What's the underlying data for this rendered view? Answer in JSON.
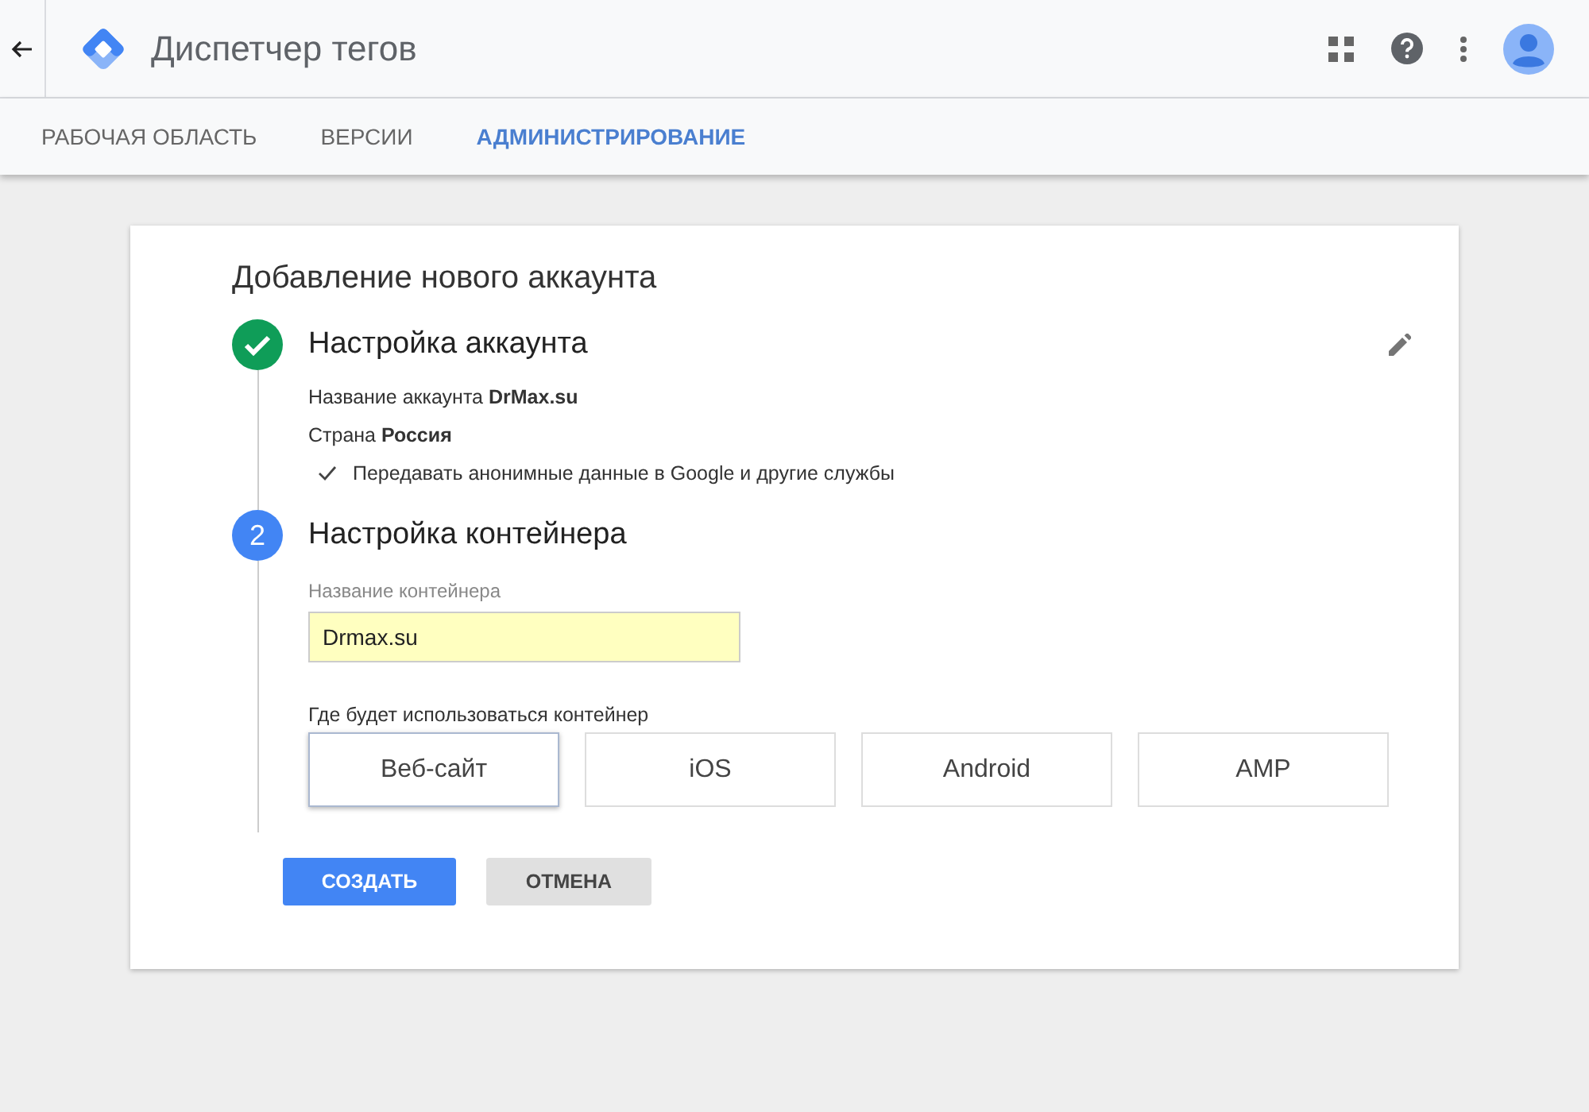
{
  "app": {
    "title": "Диспетчер тегов"
  },
  "tabs": [
    {
      "label": "РАБОЧАЯ ОБЛАСТЬ",
      "selected": false
    },
    {
      "label": "ВЕРСИИ",
      "selected": false
    },
    {
      "label": "АДМИНИСТРИРОВАНИЕ",
      "selected": true
    }
  ],
  "card": {
    "title": "Добавление нового аккаунта",
    "step_1": {
      "completed": true,
      "title": "Настройка аккаунта",
      "details": [
        "Название аккаунта **DrMax.su**",
        "Страна **Россия**"
      ],
      "option": {
        "label": "Передавать анонимные данные в Google и другие службы",
        "checked": true
      }
    },
    "step_2": {
      "completed": false,
      "number": "2",
      "title": "Настройка контейнера",
      "field": {
        "label": "Название контейнера",
        "value": "Drmax.su"
      },
      "platforms_label": "Где будет использоваться контейнер",
      "platforms": [
        {
          "label": "Веб-сайт",
          "selected": true
        },
        {
          "label": "iOS",
          "selected": false
        },
        {
          "label": "Android",
          "selected": false
        },
        {
          "label": "AMP",
          "selected": false
        }
      ]
    },
    "buttons": {
      "create": "СОЗДАТЬ",
      "cancel": "ОТМЕНА"
    }
  }
}
